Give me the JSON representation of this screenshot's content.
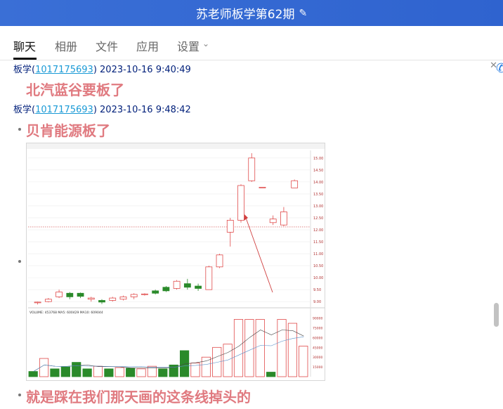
{
  "window": {
    "title": "苏老师板学第62期"
  },
  "tabs": [
    {
      "label": "聊天",
      "active": true
    },
    {
      "label": "相册",
      "active": false
    },
    {
      "label": "文件",
      "active": false
    },
    {
      "label": "应用",
      "active": false
    },
    {
      "label": "设置",
      "active": false
    }
  ],
  "messages": [
    {
      "sender": "板学",
      "id": "1017175693",
      "time": "2023-10-16 9:40:49",
      "text": "北汽蓝谷要板了"
    },
    {
      "sender": "板学",
      "id": "1017175693",
      "time": "2023-10-16 9:48:42",
      "text": "贝肯能源板了"
    },
    {
      "text": "就是踩在我们那天画的这条线掉头的"
    }
  ],
  "chart_data": {
    "type": "candlestick",
    "price_ticks": [
      "15.00",
      "14.50",
      "14.00",
      "13.50",
      "13.00",
      "12.50",
      "12.00",
      "11.50",
      "11.00",
      "10.50",
      "10.00",
      "9.50",
      "9.00"
    ],
    "volume_ticks": [
      "90000",
      "75000",
      "60000",
      "45000",
      "30000",
      "15000"
    ],
    "volume_label": "VOLUME: 453768 MA5: 600429 MA10: 609044",
    "candles": [
      {
        "o": 8.95,
        "c": 8.98,
        "h": 9.0,
        "l": 8.88,
        "up": true
      },
      {
        "o": 9.0,
        "c": 9.1,
        "h": 9.15,
        "l": 8.97,
        "up": true
      },
      {
        "o": 9.2,
        "c": 9.4,
        "h": 9.5,
        "l": 9.15,
        "up": true
      },
      {
        "o": 9.35,
        "c": 9.2,
        "h": 9.4,
        "l": 9.1,
        "up": false
      },
      {
        "o": 9.35,
        "c": 9.22,
        "h": 9.38,
        "l": 9.15,
        "up": false
      },
      {
        "o": 9.1,
        "c": 9.15,
        "h": 9.2,
        "l": 9.0,
        "up": true
      },
      {
        "o": 9.05,
        "c": 8.98,
        "h": 9.1,
        "l": 8.9,
        "up": false
      },
      {
        "o": 9.05,
        "c": 9.15,
        "h": 9.2,
        "l": 9.0,
        "up": true
      },
      {
        "o": 9.1,
        "c": 9.2,
        "h": 9.25,
        "l": 9.05,
        "up": true
      },
      {
        "o": 9.2,
        "c": 9.3,
        "h": 9.35,
        "l": 9.1,
        "up": true
      },
      {
        "o": 9.3,
        "c": 9.32,
        "h": 9.35,
        "l": 9.25,
        "up": true
      },
      {
        "o": 9.45,
        "c": 9.35,
        "h": 9.5,
        "l": 9.3,
        "up": false
      },
      {
        "o": 9.6,
        "c": 9.45,
        "h": 9.65,
        "l": 9.4,
        "up": false
      },
      {
        "o": 9.55,
        "c": 9.85,
        "h": 9.9,
        "l": 9.5,
        "up": true
      },
      {
        "o": 9.75,
        "c": 9.6,
        "h": 9.95,
        "l": 9.5,
        "up": false
      },
      {
        "o": 9.65,
        "c": 9.55,
        "h": 9.75,
        "l": 9.45,
        "up": false
      },
      {
        "o": 9.5,
        "c": 10.45,
        "h": 10.5,
        "l": 9.5,
        "up": true
      },
      {
        "o": 10.45,
        "c": 10.95,
        "h": 11.0,
        "l": 10.4,
        "up": true
      },
      {
        "o": 11.9,
        "c": 12.4,
        "h": 12.5,
        "l": 11.3,
        "up": true
      },
      {
        "o": 12.4,
        "c": 13.85,
        "h": 13.9,
        "l": 12.3,
        "up": true
      },
      {
        "o": 14.05,
        "c": 15.0,
        "h": 15.2,
        "l": 14.0,
        "up": true
      },
      {
        "o": 13.78,
        "c": 13.78,
        "h": 13.78,
        "l": 13.78,
        "up": true
      },
      {
        "o": 12.3,
        "c": 12.45,
        "h": 12.6,
        "l": 12.2,
        "up": true
      },
      {
        "o": 12.2,
        "c": 12.75,
        "h": 12.95,
        "l": 12.15,
        "up": true
      },
      {
        "o": 13.75,
        "c": 14.05,
        "h": 14.1,
        "l": 13.75,
        "up": true
      }
    ],
    "volumes": [
      {
        "v": 8000,
        "up": false
      },
      {
        "v": 28000,
        "up": true
      },
      {
        "v": 12000,
        "up": false
      },
      {
        "v": 15000,
        "up": false
      },
      {
        "v": 22000,
        "up": false
      },
      {
        "v": 12000,
        "up": false
      },
      {
        "v": 16000,
        "up": true
      },
      {
        "v": 12000,
        "up": false
      },
      {
        "v": 14000,
        "up": true
      },
      {
        "v": 13000,
        "up": false
      },
      {
        "v": 12000,
        "up": true
      },
      {
        "v": 16000,
        "up": true
      },
      {
        "v": 12000,
        "up": false
      },
      {
        "v": 18000,
        "up": false
      },
      {
        "v": 40000,
        "up": false
      },
      {
        "v": 21000,
        "up": true
      },
      {
        "v": 30000,
        "up": true
      },
      {
        "v": 45000,
        "up": true
      },
      {
        "v": 50000,
        "up": true
      },
      {
        "v": 88000,
        "up": true
      },
      {
        "v": 88000,
        "up": true
      },
      {
        "v": 88000,
        "up": true
      },
      {
        "v": 7000,
        "up": false
      },
      {
        "v": 88000,
        "up": true
      },
      {
        "v": 82000,
        "up": true
      },
      {
        "v": 47000,
        "up": true
      }
    ]
  }
}
